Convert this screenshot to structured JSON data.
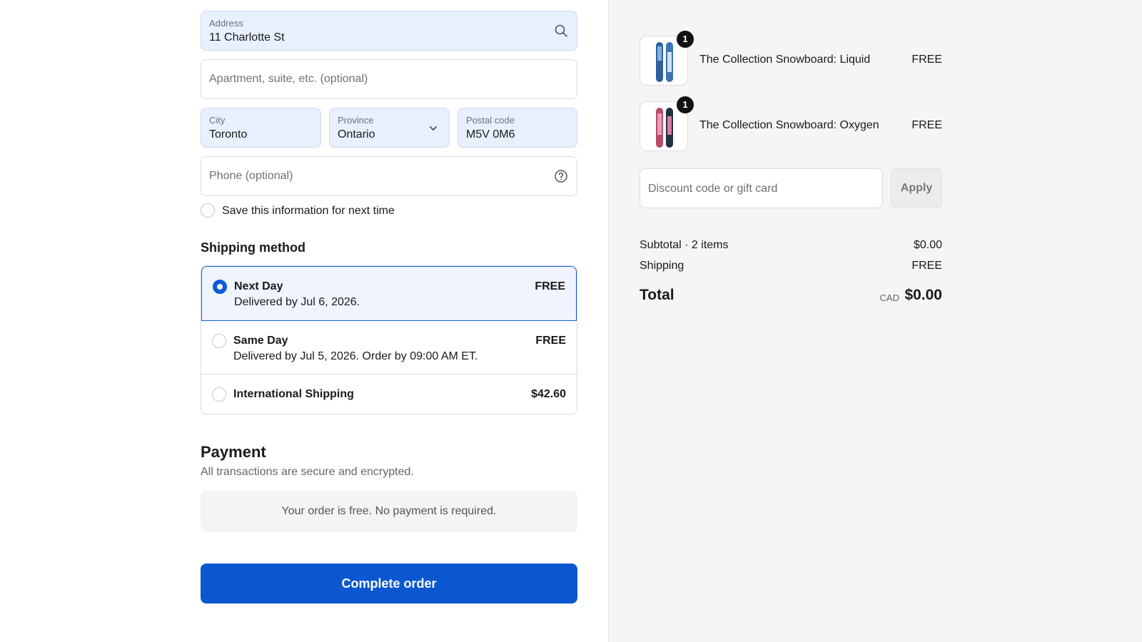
{
  "address": {
    "address_label": "Address",
    "address_value": "11 Charlotte St",
    "apartment_placeholder": "Apartment, suite, etc. (optional)",
    "city_label": "City",
    "city_value": "Toronto",
    "province_label": "Province",
    "province_value": "Ontario",
    "postal_label": "Postal code",
    "postal_value": "M5V 0M6",
    "phone_placeholder": "Phone (optional)",
    "save_info_label": "Save this information for next time"
  },
  "shipping": {
    "title": "Shipping method",
    "options": [
      {
        "name": "Next Day",
        "detail": "Delivered by Jul 6, 2026.",
        "price": "FREE",
        "selected": true
      },
      {
        "name": "Same Day",
        "detail": "Delivered by Jul 5, 2026. Order by 09:00 AM ET.",
        "price": "FREE",
        "selected": false
      },
      {
        "name": "International Shipping",
        "detail": "",
        "price": "$42.60",
        "selected": false
      }
    ]
  },
  "payment": {
    "title": "Payment",
    "subtitle": "All transactions are secure and encrypted.",
    "note": "Your order is free. No payment is required."
  },
  "complete_order_label": "Complete order",
  "summary": {
    "products": [
      {
        "name": "The Collection Snowboard: Liquid",
        "price": "FREE",
        "quantity": "1"
      },
      {
        "name": "The Collection Snowboard: Oxygen",
        "price": "FREE",
        "quantity": "1"
      }
    ],
    "discount_placeholder": "Discount code or gift card",
    "apply_label": "Apply",
    "subtotal_label": "Subtotal · 2 items",
    "subtotal_value": "$0.00",
    "shipping_label": "Shipping",
    "shipping_value": "FREE",
    "total_label": "Total",
    "currency": "CAD",
    "total_value": "$0.00"
  },
  "colors": {
    "primary": "#0b57d0",
    "filled_field": "#e8f0fe",
    "summary_bg": "#f5f5f5"
  }
}
